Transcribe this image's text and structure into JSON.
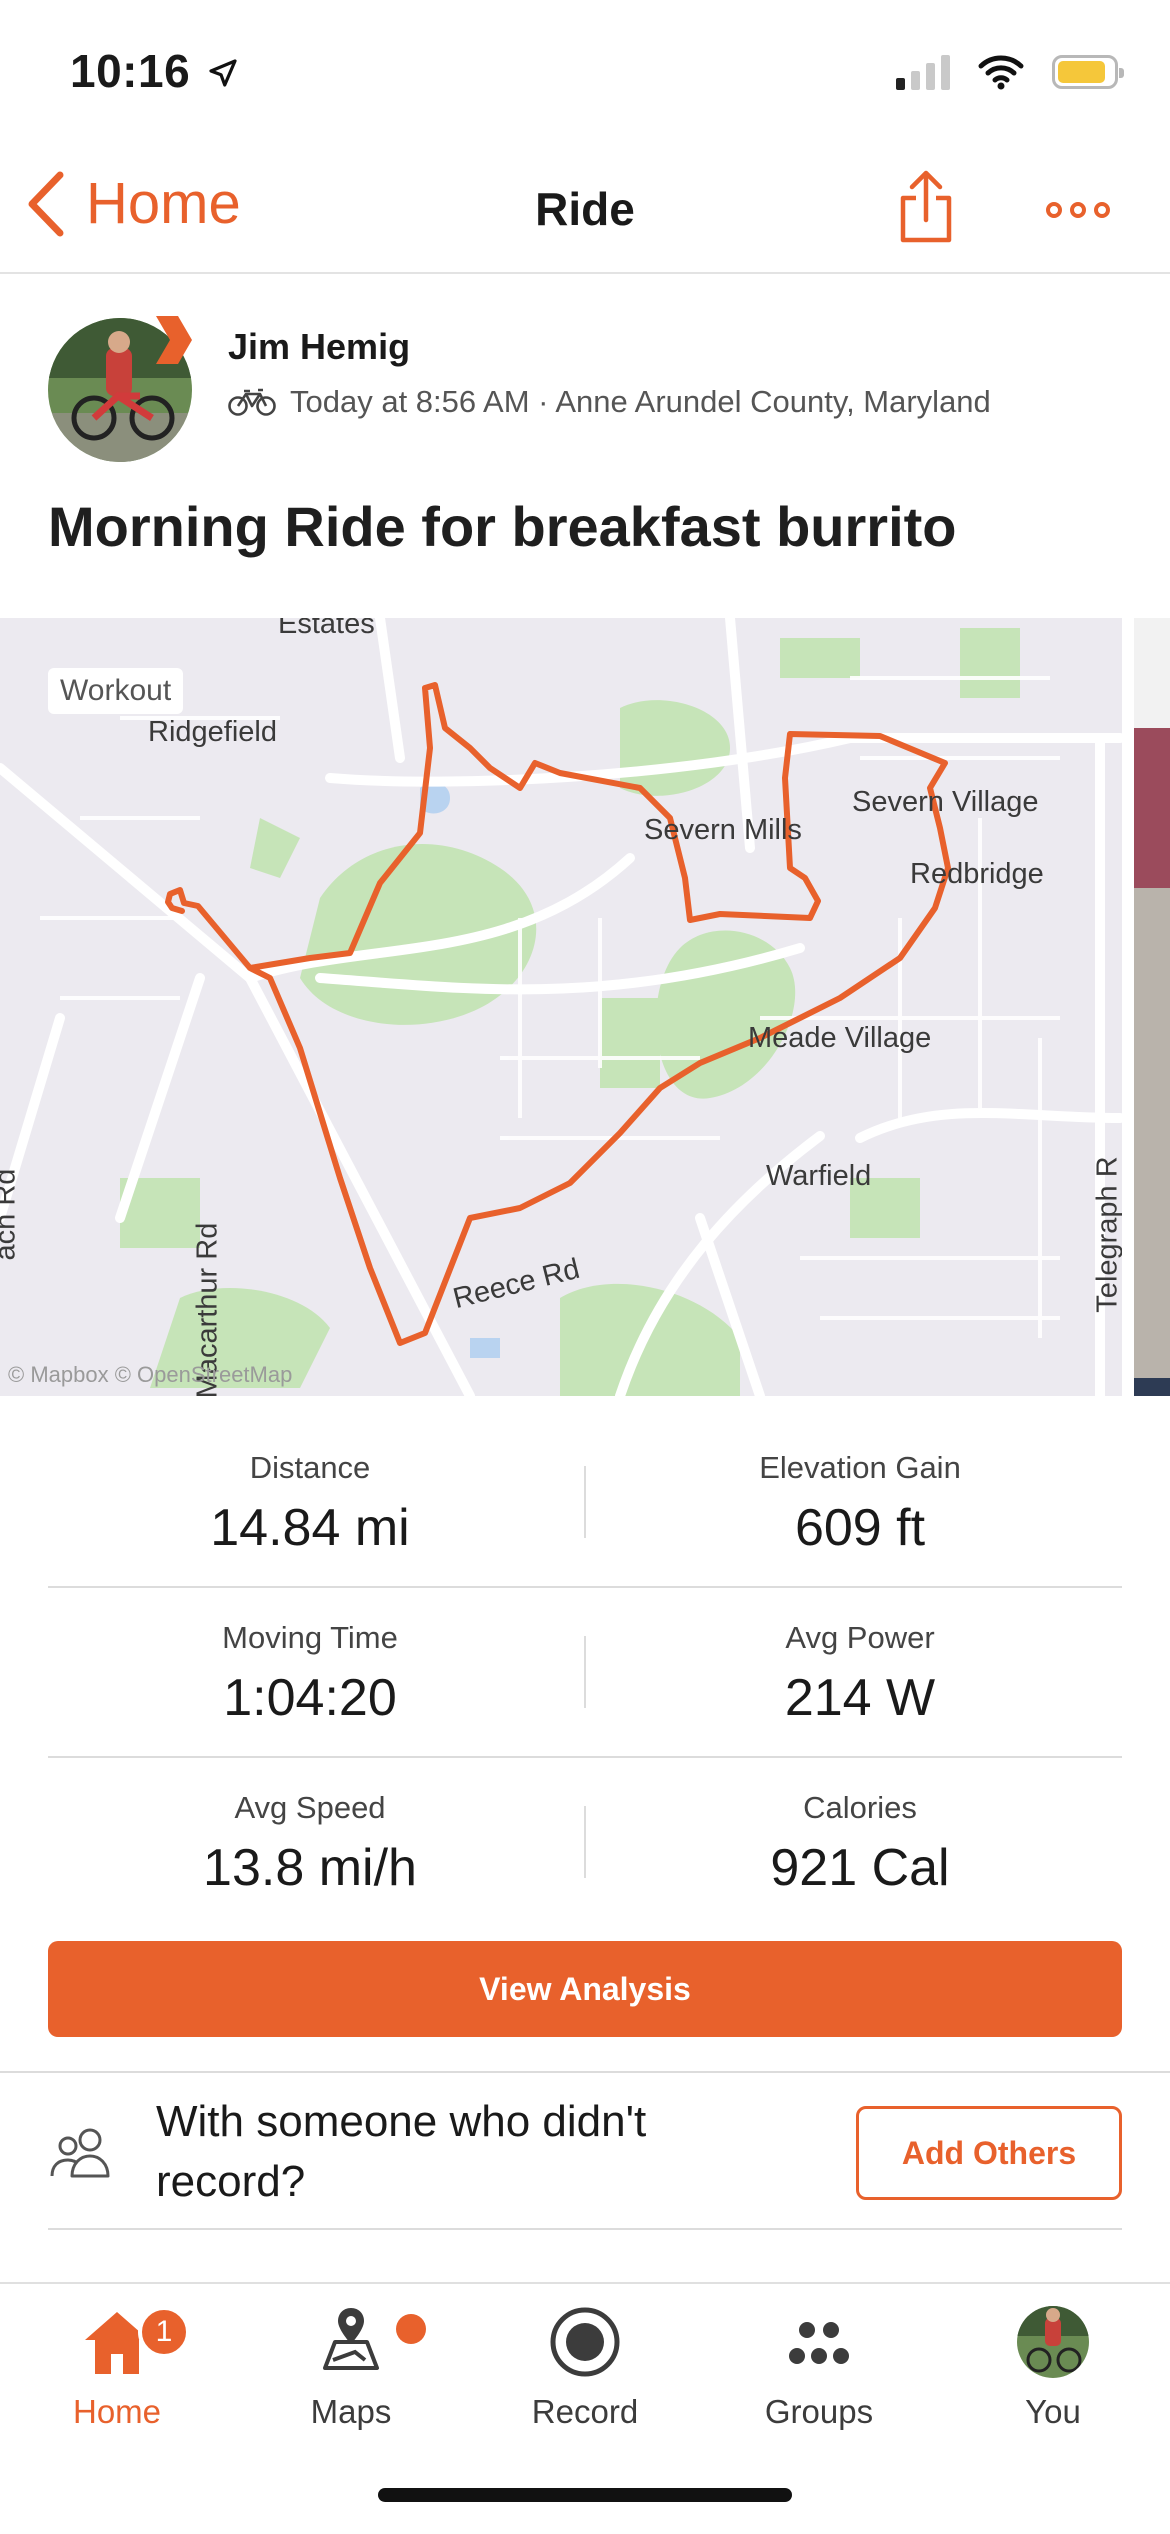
{
  "status_bar": {
    "time": "10:16"
  },
  "nav": {
    "back_label": "Home",
    "title": "Ride"
  },
  "activity": {
    "athlete_name": "Jim Hemig",
    "meta": "Today at 8:56 AM · Anne Arundel County, Maryland",
    "title": "Morning Ride for breakfast burrito"
  },
  "map": {
    "badge": "Workout",
    "labels": [
      "Estates",
      "Ridgefield",
      "Severn Mills",
      "Severn Village",
      "Redbridge",
      "Meade Village",
      "Warfield",
      "Reece Rd",
      "ach Rd",
      "Macarthur Rd",
      "Telegraph R",
      "© Mapbox © OpenStreetMap"
    ],
    "route_color": "#e8612c"
  },
  "stats": [
    {
      "label": "Distance",
      "value": "14.84 mi"
    },
    {
      "label": "Elevation Gain",
      "value": "609 ft"
    },
    {
      "label": "Moving Time",
      "value": "1:04:20"
    },
    {
      "label": "Avg Power",
      "value": "214 W"
    },
    {
      "label": "Avg Speed",
      "value": "13.8 mi/h"
    },
    {
      "label": "Calories",
      "value": "921 Cal"
    }
  ],
  "analysis_button": "View Analysis",
  "with_others": {
    "text": "With someone who didn't record?",
    "button": "Add Others"
  },
  "tabbar": {
    "items": [
      {
        "label": "Home",
        "badge": "1"
      },
      {
        "label": "Maps"
      },
      {
        "label": "Record"
      },
      {
        "label": "Groups"
      },
      {
        "label": "You"
      }
    ]
  },
  "colors": {
    "accent": "#e8612c",
    "battery": "#f5c73a"
  }
}
